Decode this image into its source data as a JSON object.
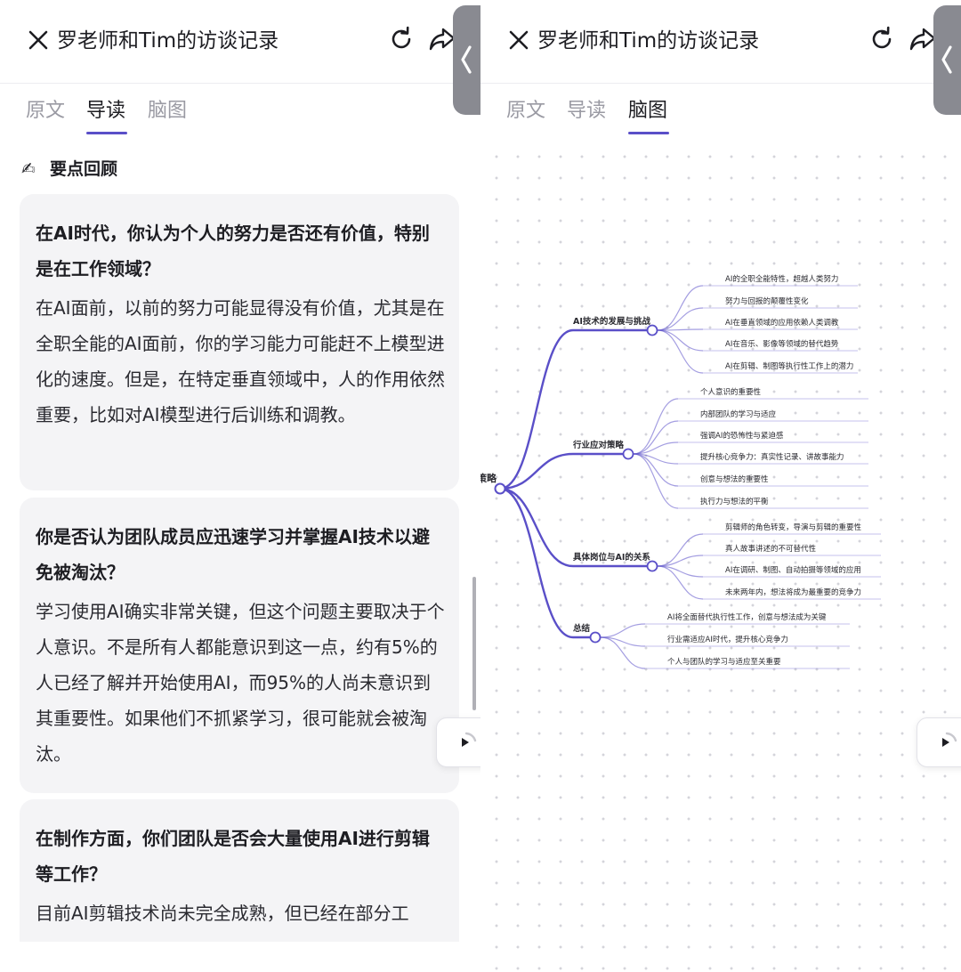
{
  "header": {
    "title": "罗老师和Tim的访谈记录",
    "close_icon": "close-icon",
    "refresh_icon": "refresh-icon",
    "share_icon": "share-icon",
    "collapse_icon": "chevron-left-icon"
  },
  "tabs": [
    {
      "label": "原文"
    },
    {
      "label": "导读"
    },
    {
      "label": "脑图"
    }
  ],
  "left_panel": {
    "active_tab": "导读",
    "section_title": "要点回顾",
    "section_icon": "writing-hand-icon",
    "cards": [
      {
        "question": "在AI时代，你认为个人的努力是否还有价值，特别是在工作领域？",
        "answer": "在AI面前，以前的努力可能显得没有价值，尤其是在全职全能的AI面前，你的学习能力可能赶不上模型进化的速度。但是，在特定垂直领域中，人的作用依然重要，比如对AI模型进行后训练和调教。"
      },
      {
        "question": "你是否认为团队成员应迅速学习并掌握AI技术以避免被淘汰？",
        "answer": "学习使用AI确实非常关键，但这个问题主要取决于个人意识。不是所有人都能意识到这一点，约有5%的人已经了解并开始使用AI，而95%的人尚未意识到其重要性。如果他们不抓紧学习，很可能就会被淘汰。"
      },
      {
        "question": "在制作方面，你们团队是否会大量使用AI进行剪辑等工作？",
        "answer": "目前AI剪辑技术尚未完全成熟，但已经在部分工"
      }
    ]
  },
  "right_panel": {
    "active_tab": "脑图",
    "mindmap": {
      "root": "策略",
      "branches": [
        {
          "label": "AI技术的发展与挑战",
          "children": [
            "AI的全职全能特性，超越人类努力",
            "努力与回报的颠覆性变化",
            "AI在垂直领域的应用依赖人类调教",
            "AI在音乐、影像等领域的替代趋势",
            "AI在剪辑、制图等执行性工作上的潜力"
          ]
        },
        {
          "label": "行业应对策略",
          "children": [
            "个人意识的重要性",
            "内部团队的学习与适应",
            "强调AI的恐怖性与紧迫感",
            "提升核心竞争力：真实性记录、讲故事能力",
            "创意与想法的重要性",
            "执行力与想法的平衡"
          ]
        },
        {
          "label": "具体岗位与AI的关系",
          "children": [
            "剪辑师的角色转变，导演与剪辑的重要性",
            "真人故事讲述的不可替代性",
            "AI在调研、制图、自动拍摄等领域的应用",
            "未来两年内，想法将成为最重要的竞争力"
          ]
        },
        {
          "label": "总结",
          "children": [
            "AI将全面替代执行性工作，创意与想法成为关键",
            "行业需适应AI时代，提升核心竞争力",
            "个人与团队的学习与适应至关重要"
          ]
        }
      ]
    }
  },
  "colors": {
    "accent": "#5a4fc8",
    "mindmap_line": "#5a4fc8",
    "card_bg": "#f4f4f6",
    "handle_bg": "#898a91"
  }
}
